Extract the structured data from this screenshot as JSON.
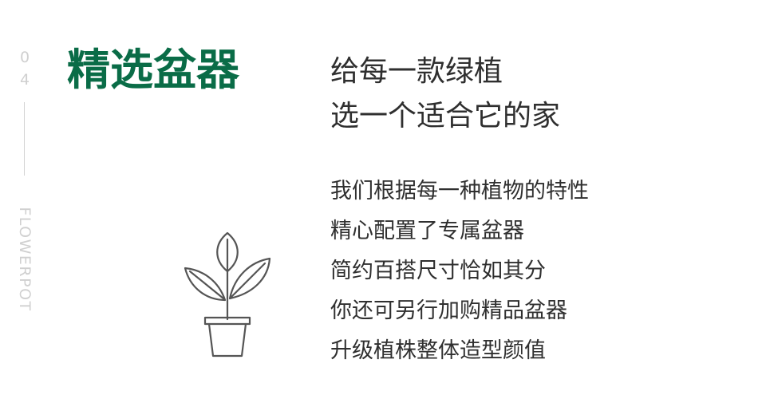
{
  "side": {
    "number_digits": [
      "0",
      "4"
    ],
    "word": "FLOWERPOT"
  },
  "title": "精选盆器",
  "tagline": [
    "给每一款绿植",
    "选一个适合它的家"
  ],
  "body": [
    "我们根据每一种植物的特性",
    "精心配置了专属盆器",
    "简约百搭尺寸恰如其分",
    "你还可另行加购精品盆器",
    "升级植株整体造型颜值"
  ],
  "colors": {
    "title_green": "#0a6c47",
    "text_dark": "#2f2f2f",
    "side_gray": "#d0d0d0",
    "icon_stroke": "#555555"
  },
  "icons": {
    "plant": "potted-plant-icon"
  }
}
